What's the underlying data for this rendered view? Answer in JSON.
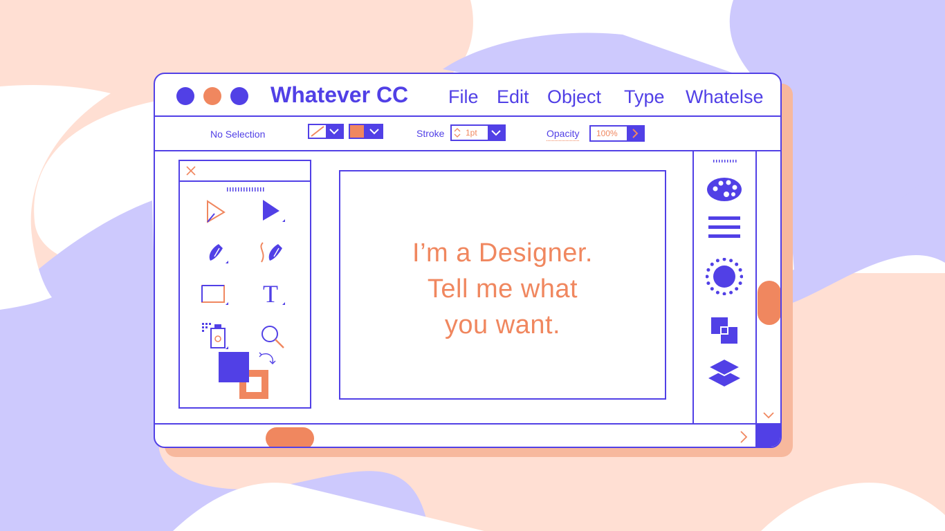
{
  "colors": {
    "purple": "#5140e6",
    "orange": "#f0875f",
    "lavender": "#cdc9fd",
    "peach": "#ffdfd3"
  },
  "window": {
    "title": "Whatever CC",
    "controls": [
      "close-dot",
      "minimize-dot",
      "maximize-dot"
    ],
    "menu": [
      "File",
      "Edit",
      "Object",
      "Type",
      "Whatelse"
    ]
  },
  "options_bar": {
    "selection": "No Selection",
    "stroke_label": "Stroke",
    "stroke_value": "1pt",
    "opacity_label": "Opacity",
    "opacity_value": "100%"
  },
  "tools": {
    "items": [
      "selection-tool",
      "direct-selection-tool",
      "pen-tool",
      "curvature-pen-tool",
      "rectangle-tool",
      "type-tool",
      "spray-tool",
      "zoom-tool"
    ],
    "fill_color": "#5140e6",
    "stroke_color": "#f0875f"
  },
  "canvas": {
    "lines": [
      "I’m a Designer.",
      "Tell me what",
      "you want."
    ]
  },
  "right_panel": {
    "icons": [
      "palette-icon",
      "menu-lines-icon",
      "sun-icon",
      "pathfinder-icon",
      "layers-icon"
    ]
  }
}
